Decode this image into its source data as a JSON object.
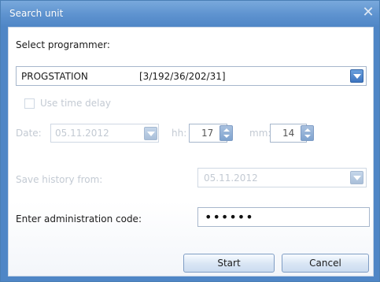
{
  "window": {
    "title": "Search unit",
    "close_glyph": "✕"
  },
  "programmer": {
    "label": "Select programmer:",
    "selected_name": "PROGSTATION",
    "selected_address": "[3/192/36/202/31]"
  },
  "time_delay": {
    "label": "Use time delay",
    "checked": false,
    "date_label": "Date:",
    "date_value": "05.11.2012",
    "hh_label": "hh:",
    "hh_value": "17",
    "mm_label": "mm:",
    "mm_value": "14"
  },
  "history": {
    "label": "Save history from:",
    "value": "05.11.2012"
  },
  "admin_code": {
    "label": "Enter administration code:",
    "value": "••••••"
  },
  "buttons": {
    "start": "Start",
    "cancel": "Cancel"
  },
  "colors": {
    "titlebar": "#4f86c6",
    "accent": "#3d75c0",
    "disabled_text": "#c3cad3"
  },
  "icons": {
    "dropdown": "chevron-down-icon",
    "spinner": "spin-updown-icon",
    "close": "close-icon"
  }
}
